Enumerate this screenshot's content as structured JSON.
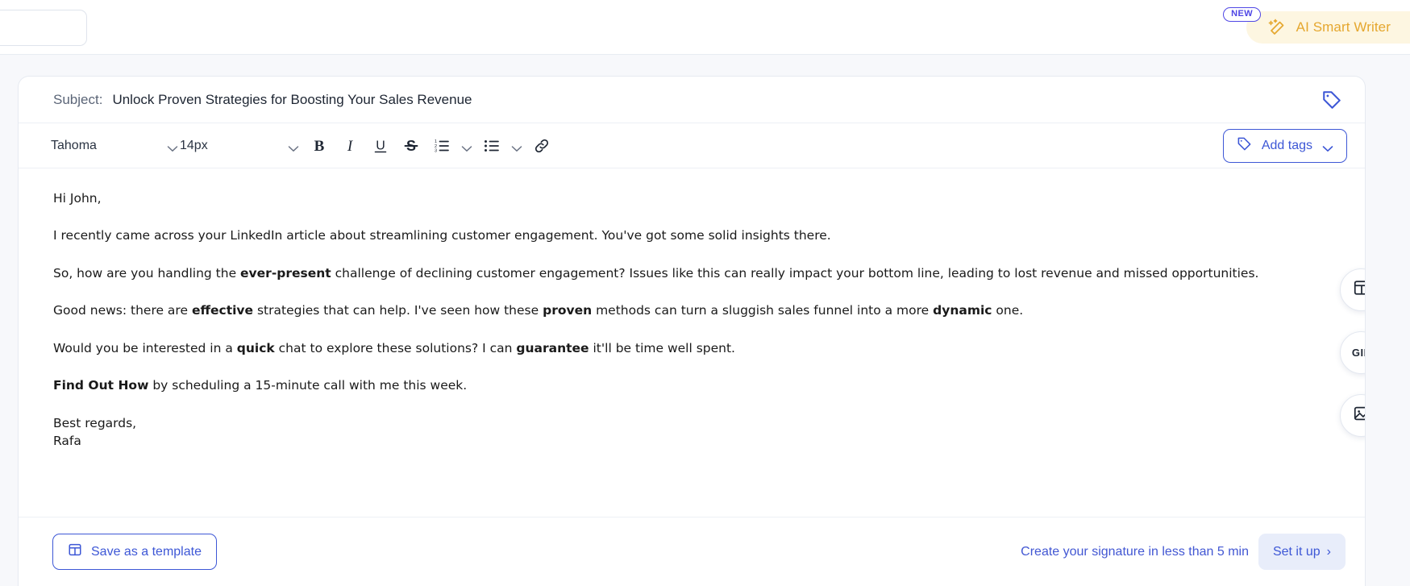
{
  "header": {
    "ai_writer": {
      "label": "AI Smart Writer",
      "badge": "NEW",
      "icon": "magic-wand-icon",
      "text_color": "#e5a72e",
      "bg_color": "#fdf6e1",
      "badge_color": "#4f46e5"
    }
  },
  "subject": {
    "label": "Subject:",
    "value": "Unlock Proven Strategies for Boosting Your Sales Revenue",
    "tag_icon": "tag-icon"
  },
  "toolbar": {
    "font_family": "Tahoma",
    "font_size": "14px",
    "buttons": [
      {
        "name": "bold",
        "glyph": "B"
      },
      {
        "name": "italic",
        "glyph": "I"
      },
      {
        "name": "underline",
        "glyph": "U"
      },
      {
        "name": "strikethrough",
        "glyph": "S"
      },
      {
        "name": "ordered-list",
        "glyph": "1."
      },
      {
        "name": "unordered-list",
        "glyph": "•"
      },
      {
        "name": "link",
        "glyph": "link"
      }
    ],
    "add_tags_label": "Add tags",
    "accent_color": "#3d57d6"
  },
  "body": {
    "greeting": "Hi John,",
    "p1": "I recently came across your LinkedIn article about streamlining customer engagement. You've got some solid insights there.",
    "p2_a": "So, how are you handling the ",
    "p2_b": "ever-present",
    "p2_c": " challenge of declining customer engagement? Issues like this can really impact your bottom line, leading to lost revenue and missed opportunities.",
    "p3_a": "Good news: there are ",
    "p3_b": "effective",
    "p3_c": " strategies that can help. I've seen how these ",
    "p3_d": "proven",
    "p3_e": " methods can turn a sluggish sales funnel into a more ",
    "p3_f": "dynamic",
    "p3_g": " one.",
    "p4_a": "Would you be interested in a ",
    "p4_b": "quick",
    "p4_c": " chat to explore these solutions? I can ",
    "p4_d": "guarantee",
    "p4_e": " it'll be time well spent.",
    "p5_a": "Find Out How",
    "p5_b": " by scheduling a 15-minute call with me this week.",
    "signoff": "Best regards,",
    "sender": "Rafa"
  },
  "side_tools": [
    {
      "name": "template-icon",
      "label": ""
    },
    {
      "name": "gif-icon",
      "label": "GIF"
    },
    {
      "name": "image-icon",
      "label": ""
    }
  ],
  "footer": {
    "save_template_label": "Save as a template",
    "signature_hint": "Create your signature in less than 5 min",
    "setup_label": "Set it up",
    "setup_chevron": "›",
    "accent_color": "#3d57d6",
    "setup_bg": "#e8edfa"
  }
}
